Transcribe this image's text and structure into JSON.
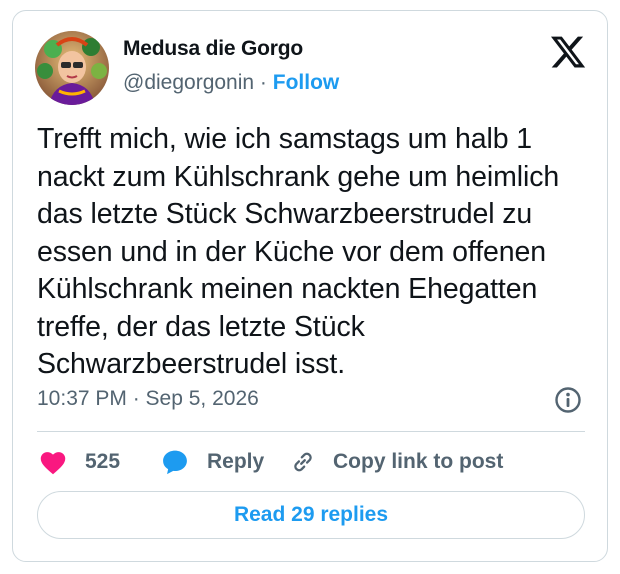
{
  "author": {
    "display_name": "Medusa die Gorgo",
    "handle": "@diegorgonin",
    "separator": "·",
    "follow_label": "Follow"
  },
  "tweet": {
    "text": "Trefft mich, wie ich samstags um halb 1 nackt zum Kühlschrank gehe um heimlich das letzte Stück Schwarzbeerstrudel zu essen und in der Küche vor dem offenen Kühlschrank meinen nackten Ehegatten treffe, der das letzte Stück Schwarzbeerstrudel isst.",
    "timestamp": "10:37 PM · Sep 5, 2026"
  },
  "actions": {
    "like_count": "525",
    "reply_label": "Reply",
    "copy_link_label": "Copy link to post"
  },
  "read_replies_label": "Read 29 replies",
  "icons": {
    "brand": "x-logo-icon",
    "info": "info-icon",
    "like": "heart-icon",
    "reply": "reply-bubble-icon",
    "copy": "link-icon"
  },
  "colors": {
    "accent": "#1d9bf0",
    "like": "#f91880",
    "muted": "#536471",
    "text": "#0f1419",
    "border": "#cfd9de"
  }
}
